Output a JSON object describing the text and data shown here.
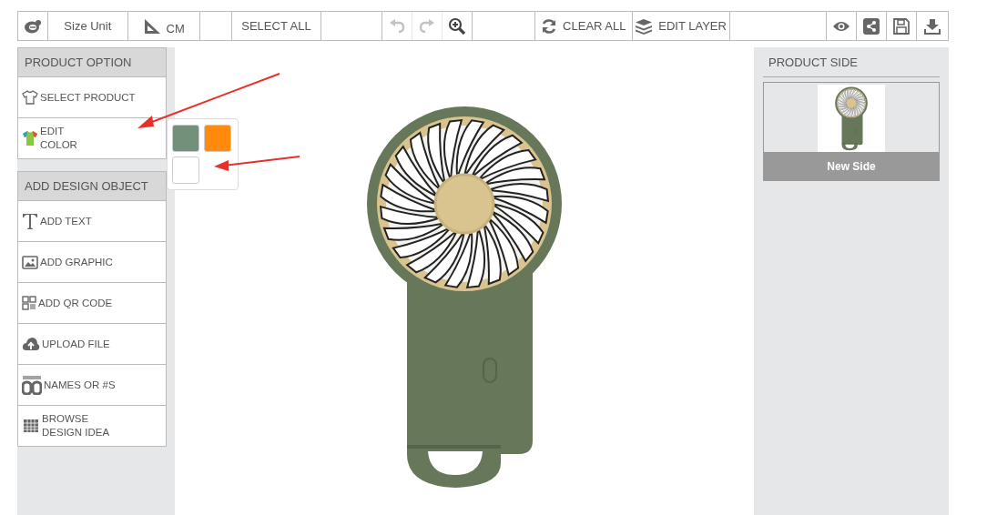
{
  "toolbar": {
    "size_unit_label": "Size Unit",
    "unit": "CM",
    "select_all": "SELECT ALL",
    "undo": {
      "disabled": true
    },
    "redo": {
      "disabled": true
    },
    "clear_all": "CLEAR ALL",
    "edit_layer": "EDIT LAYER"
  },
  "left_panel": [
    {
      "title": "PRODUCT OPTION",
      "items": [
        {
          "label": "SELECT PRODUCT"
        },
        {
          "label": "EDIT\nCOLOR"
        }
      ]
    },
    {
      "title": "ADD DESIGN OBJECT",
      "items": [
        {
          "label": "ADD TEXT"
        },
        {
          "label": "ADD GRAPHIC"
        },
        {
          "label": "ADD QR CODE"
        },
        {
          "label": "UPLOAD FILE"
        },
        {
          "label": "NAMES OR #S"
        },
        {
          "label": "BROWSE\nDESIGN IDEA"
        }
      ]
    }
  ],
  "color_swatches": [
    {
      "color": "#72907a"
    },
    {
      "color": "#ff8a0d"
    },
    {
      "color": "#ffffff"
    }
  ],
  "right_panel": {
    "title": "PRODUCT SIDE",
    "sides": [
      {
        "label": "New Side"
      }
    ]
  }
}
